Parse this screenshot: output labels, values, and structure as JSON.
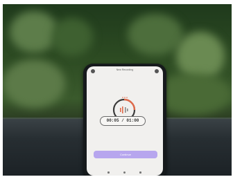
{
  "app": {
    "title": "New Recording"
  },
  "timer": {
    "elapsed": "00:05",
    "total": "01:00",
    "display": "00:05 / 01:00",
    "progress_fraction": 0.08
  },
  "actions": {
    "continue_label": "Continue"
  },
  "colors": {
    "accent": "#b7a6ee",
    "ring_active": "#e06a4a",
    "ring_track": "#3a3a3a"
  },
  "icons": {
    "back": "back-arrow-icon",
    "settings": "settings-icon",
    "waveform": "waveform-icon"
  }
}
